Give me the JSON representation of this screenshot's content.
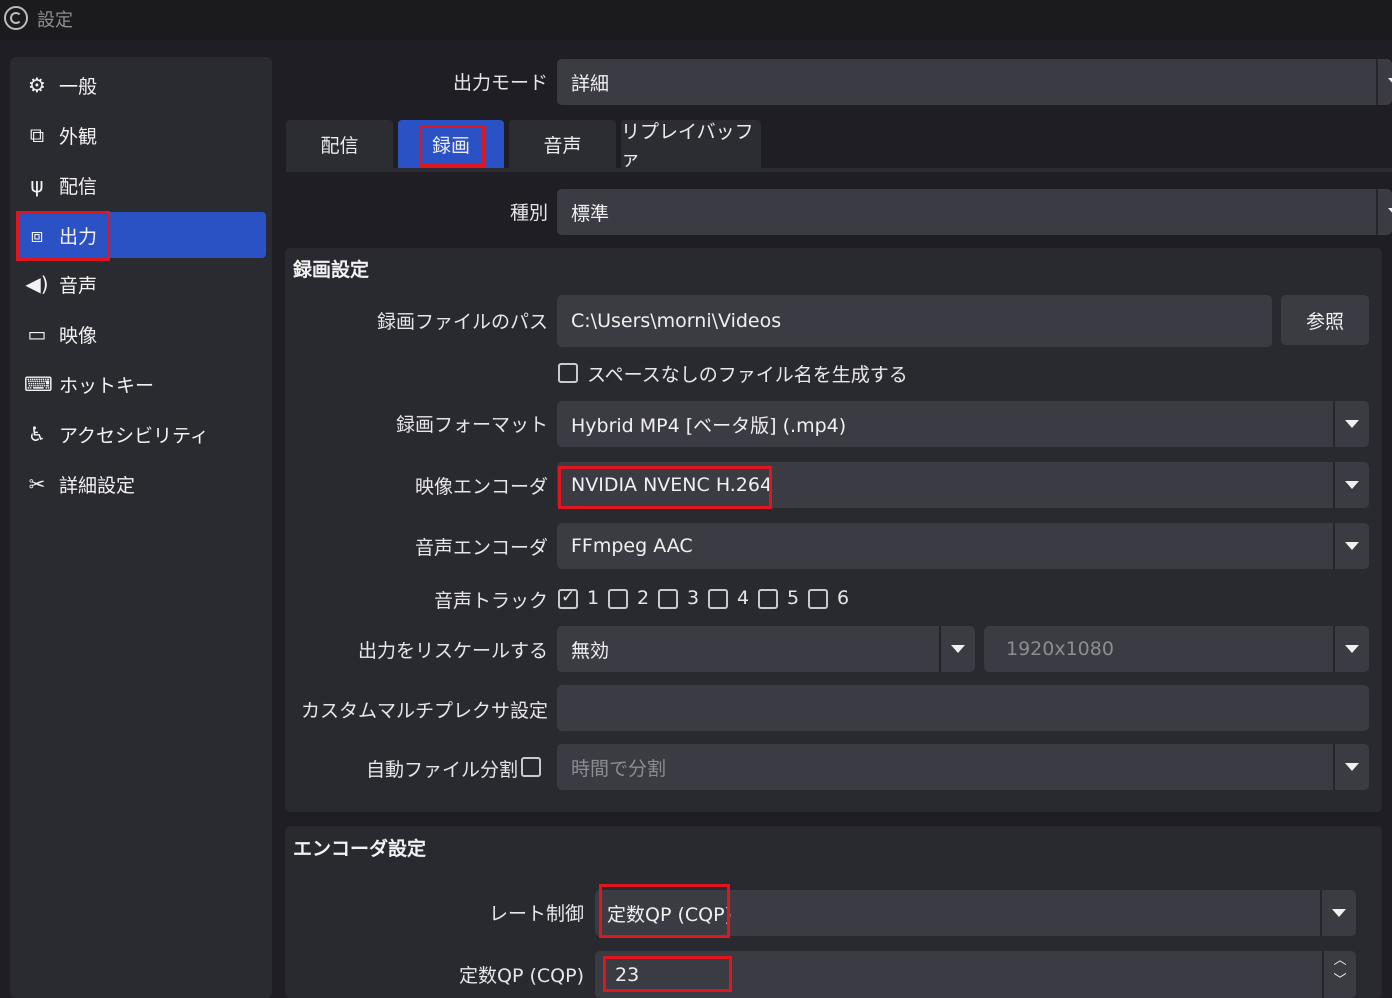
{
  "window": {
    "title": "設定"
  },
  "sidebar": {
    "items": [
      {
        "label": "一般",
        "icon": "gear-icon"
      },
      {
        "label": "外観",
        "icon": "appearance-icon"
      },
      {
        "label": "配信",
        "icon": "antenna-icon"
      },
      {
        "label": "出力",
        "icon": "output-icon",
        "active": true
      },
      {
        "label": "音声",
        "icon": "speaker-icon"
      },
      {
        "label": "映像",
        "icon": "monitor-icon"
      },
      {
        "label": "ホットキー",
        "icon": "keyboard-icon"
      },
      {
        "label": "アクセシビリティ",
        "icon": "accessibility-icon"
      },
      {
        "label": "詳細設定",
        "icon": "tools-icon"
      }
    ]
  },
  "output_mode": {
    "label": "出力モード",
    "value": "詳細"
  },
  "tabs": [
    {
      "label": "配信"
    },
    {
      "label": "録画",
      "active": true
    },
    {
      "label": "音声"
    },
    {
      "label": "リプレイバッファ"
    }
  ],
  "type": {
    "label": "種別",
    "value": "標準"
  },
  "recording": {
    "section_title": "録画設定",
    "path_label": "録画ファイルのパス",
    "path_value": "C:\\Users\\morni\\Videos",
    "browse_label": "参照",
    "nospace_label": "スペースなしのファイル名を生成する",
    "format_label": "録画フォーマット",
    "format_value": "Hybrid MP4 [ベータ版] (.mp4)",
    "video_encoder_label": "映像エンコーダ",
    "video_encoder_value": "NVIDIA NVENC H.264",
    "audio_encoder_label": "音声エンコーダ",
    "audio_encoder_value": "FFmpeg AAC",
    "audio_track_label": "音声トラック",
    "tracks": [
      "1",
      "2",
      "3",
      "4",
      "5",
      "6"
    ],
    "tracks_checked": [
      true,
      false,
      false,
      false,
      false,
      false
    ],
    "rescale_label": "出力をリスケールする",
    "rescale_value": "無効",
    "rescale_resolution": "1920x1080",
    "muxer_label": "カスタムマルチプレクサ設定",
    "muxer_value": "",
    "autosplit_label": "自動ファイル分割",
    "autosplit_value": "時間で分割"
  },
  "encoder": {
    "section_title": "エンコーダ設定",
    "rate_control_label": "レート制御",
    "rate_control_value": "定数QP (CQP)",
    "cqp_label": "定数QP (CQP)",
    "cqp_value": "23"
  },
  "colors": {
    "accent": "#2b52c5",
    "highlight": "#e0161f",
    "background": "#1f1e24",
    "panel": "#292930",
    "field": "#3b3b43"
  }
}
